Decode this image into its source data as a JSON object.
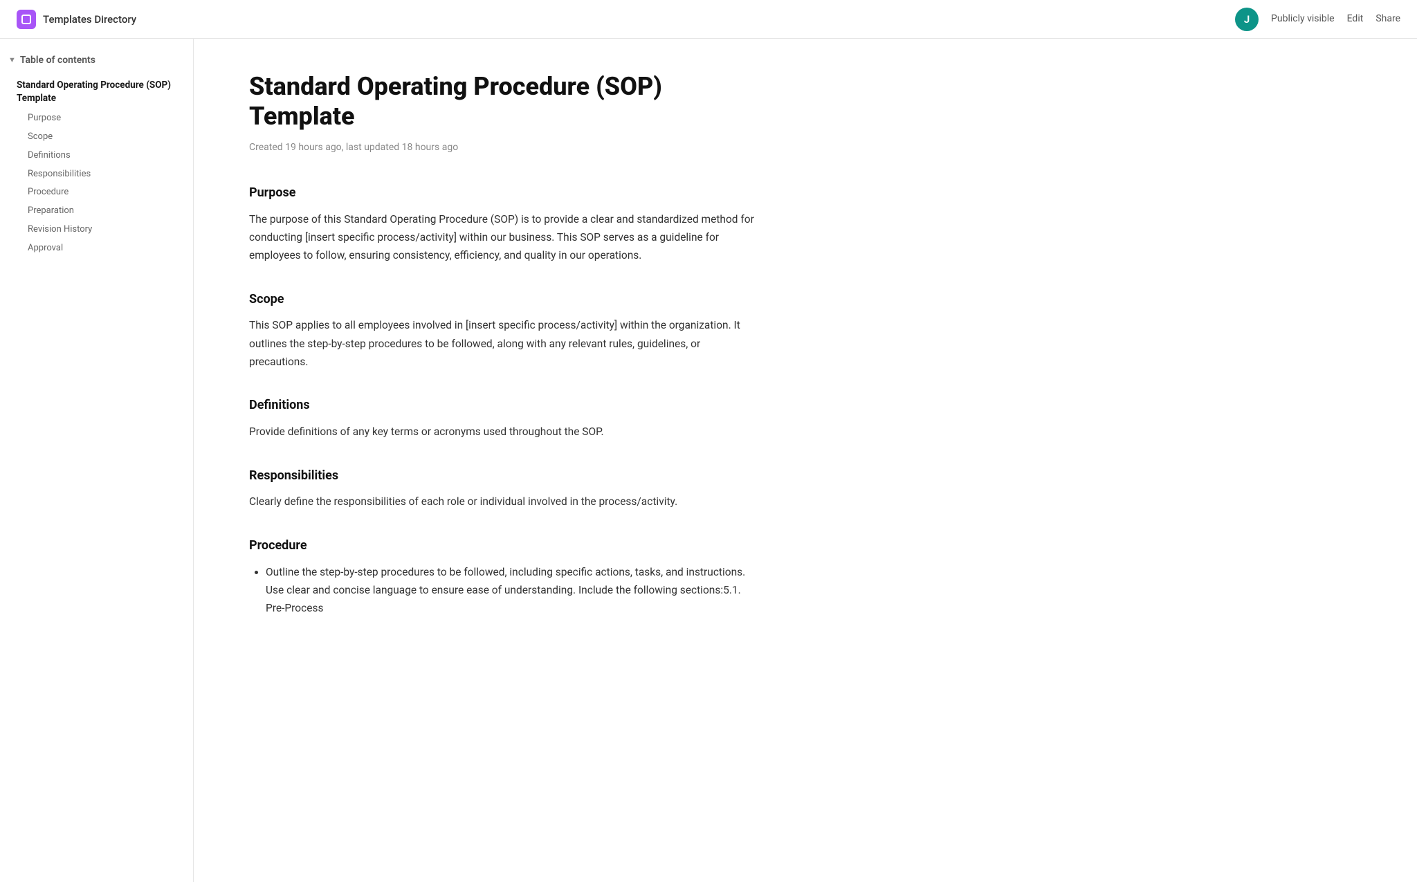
{
  "header": {
    "app_icon_label": "app-icon",
    "app_title": "Templates Directory",
    "avatar_letter": "J",
    "publicly_visible_label": "Publicly visible",
    "edit_label": "Edit",
    "share_label": "Share"
  },
  "sidebar": {
    "toc_title": "Table of contents",
    "toc_chevron": "▼",
    "top_item": "Standard Operating Procedure (SOP) Template",
    "sub_items": [
      {
        "label": "Purpose"
      },
      {
        "label": "Scope"
      },
      {
        "label": "Definitions"
      },
      {
        "label": "Responsibilities"
      },
      {
        "label": "Procedure"
      },
      {
        "label": "Preparation"
      },
      {
        "label": "Revision History"
      },
      {
        "label": "Approval"
      }
    ]
  },
  "document": {
    "title": "Standard Operating Procedure (SOP) Template",
    "meta": "Created 19 hours ago, last updated 18 hours ago",
    "sections": [
      {
        "id": "purpose",
        "heading": "Purpose",
        "body": "The purpose of this Standard Operating Procedure (SOP) is to provide a clear and standardized method for conducting [insert specific process/activity] within our business. This SOP serves as a guideline for employees to follow, ensuring consistency, efficiency, and quality in our operations.",
        "list": []
      },
      {
        "id": "scope",
        "heading": "Scope",
        "body": "This SOP applies to all employees involved in [insert specific process/activity] within the organization. It outlines the step-by-step procedures to be followed, along with any relevant rules, guidelines, or precautions.",
        "list": []
      },
      {
        "id": "definitions",
        "heading": "Definitions",
        "body": "Provide definitions of any key terms or acronyms used throughout the SOP.",
        "list": []
      },
      {
        "id": "responsibilities",
        "heading": "Responsibilities",
        "body": "Clearly define the responsibilities of each role or individual involved in the process/activity.",
        "list": []
      },
      {
        "id": "procedure",
        "heading": "Procedure",
        "body": "",
        "list": [
          "Outline the step-by-step procedures to be followed, including specific actions, tasks, and instructions. Use clear and concise language to ensure ease of understanding. Include the following sections:5.1. Pre-Process"
        ]
      }
    ]
  }
}
